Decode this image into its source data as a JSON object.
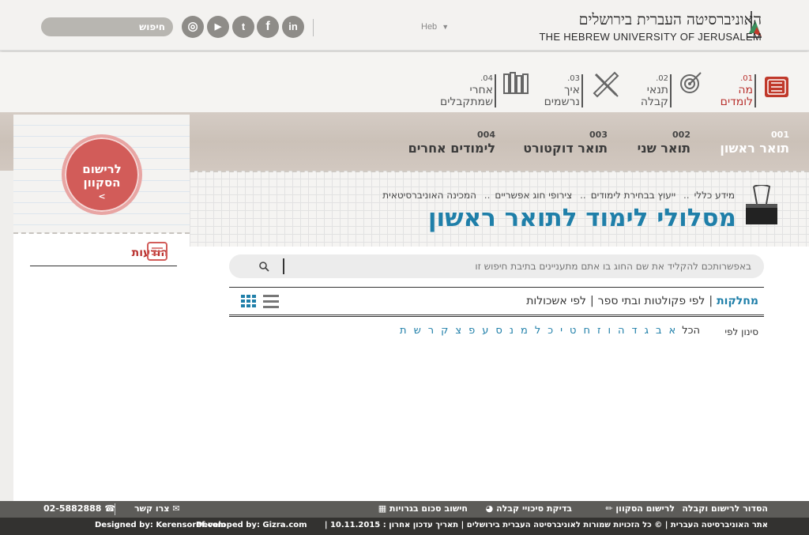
{
  "header": {
    "logo_he": "האוניברסיטה העברית בירושלים",
    "logo_en": "THE HEBREW UNIVERSITY OF JERUSALEM",
    "lang": "Heb",
    "search_label": "חיפוש",
    "social": {
      "linkedin": "in",
      "facebook": "f",
      "twitter": "t",
      "youtube": "▶",
      "instagram": "◎"
    }
  },
  "nav2": [
    {
      "num": "01.",
      "label_1": "מה",
      "label_2": "לומדים",
      "active": true,
      "icon": "book-icon"
    },
    {
      "num": "02.",
      "label_1": "תנאי",
      "label_2": "קבלה",
      "active": false,
      "icon": "target-icon"
    },
    {
      "num": "03.",
      "label_1": "איך",
      "label_2": "נרשמים",
      "active": false,
      "icon": "pencil-ruler-icon"
    },
    {
      "num": "04.",
      "label_1": "אחרי",
      "label_2": "שמתקבלים",
      "active": false,
      "icon": "books-icon"
    }
  ],
  "tabs": [
    {
      "num": "001",
      "label": "תואר ראשון",
      "active": true
    },
    {
      "num": "002",
      "label": "תואר שני",
      "active": false
    },
    {
      "num": "003",
      "label": "תואר דוקטורט",
      "active": false
    },
    {
      "num": "004",
      "label": "לימודים אחרים",
      "active": false
    }
  ],
  "register_circle": {
    "line1": "לרישום",
    "line2": "הסקוון",
    "arrow": ">"
  },
  "notices_title": "הודעות",
  "breadcrumb": [
    "מידע כללי",
    "ייעוץ בבחירת לימודים",
    "צירופי חוג אפשריים",
    "המכינה האוניברסיטאית"
  ],
  "breadcrumb_sep": "..",
  "page_title": "מסלולי לימוד לתואר ראשון",
  "search_main_placeholder": "באפשרותכם להקליד את שם החוג בו אתם מתעניינים בתיבת חיפוש זו",
  "filters": [
    {
      "label": "מחלקות",
      "active": true
    },
    {
      "label": "לפי פקולטות ובתי ספר",
      "active": false
    },
    {
      "label": "לפי אשכולות",
      "active": false
    }
  ],
  "alpha_label": "סינון לפי",
  "alpha_all": "הכל",
  "alphabet": [
    "א",
    "ב",
    "ג",
    "ד",
    "ה",
    "ו",
    "ז",
    "ח",
    "ט",
    "י",
    "כ",
    "ל",
    "מ",
    "נ",
    "ס",
    "ע",
    "פ",
    "צ",
    "ק",
    "ר",
    "ש",
    "ת"
  ],
  "footer": {
    "links": [
      "הסדור לרישום וקבלה",
      "לרישום הסקוון",
      "בדיקת סיכויי קבלה",
      "חישוב סכום בגרויות"
    ],
    "contact_label": "צרו קשר",
    "phone": "02-5882888",
    "copyright": "אתר האוניברסיטה העברית | © כל הזכויות שמורות לאוניברסיטה העברית בירושלים | תאריך עדכון אחרון : 10.11.2015 |",
    "designed_by": "Designed by: Kerensoref.com",
    "developed_by": "Developed by: Gizra.com"
  },
  "colors": {
    "accent_red": "#b8302d",
    "link_blue": "#1f7fa9",
    "footer_dark": "#333230"
  }
}
